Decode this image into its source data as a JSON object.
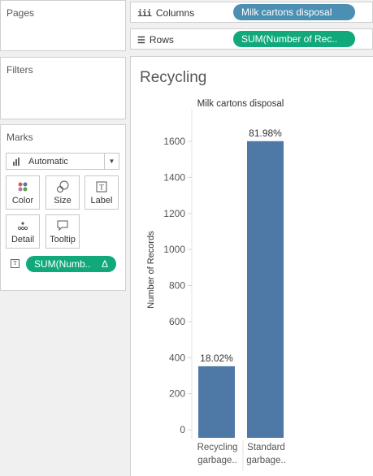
{
  "sidebar": {
    "pages_title": "Pages",
    "filters_title": "Filters",
    "marks_title": "Marks",
    "mark_type": "Automatic",
    "buttons": {
      "color": "Color",
      "size": "Size",
      "label": "Label",
      "detail": "Detail",
      "tooltip": "Tooltip"
    },
    "mark_pill": "SUM(Numb..",
    "mark_pill_delta": "Δ"
  },
  "shelves": {
    "columns_label": "Columns",
    "columns_pill": "Milk cartons disposal",
    "rows_label": "Rows",
    "rows_pill": "SUM(Number of Rec.."
  },
  "view": {
    "title": "Recycling"
  },
  "colors": {
    "bar": "#4e79a7",
    "green_pill": "#11a97b",
    "blue_pill": "#4b8fb2"
  },
  "chart_data": {
    "type": "bar",
    "title": "Milk cartons disposal",
    "xlabel": "",
    "ylabel": "Number of Records",
    "categories": [
      "Recycling garbage..",
      "Standard garbage.."
    ],
    "category_lines": [
      [
        "Recycling",
        "garbage.."
      ],
      [
        "Standard",
        "garbage.."
      ]
    ],
    "values": [
      352,
      1601
    ],
    "labels": [
      "18.02%",
      "81.98%"
    ],
    "yticks": [
      0,
      200,
      400,
      600,
      800,
      1000,
      1200,
      1400,
      1600
    ],
    "ylim": [
      0,
      1700
    ],
    "grid": false
  }
}
